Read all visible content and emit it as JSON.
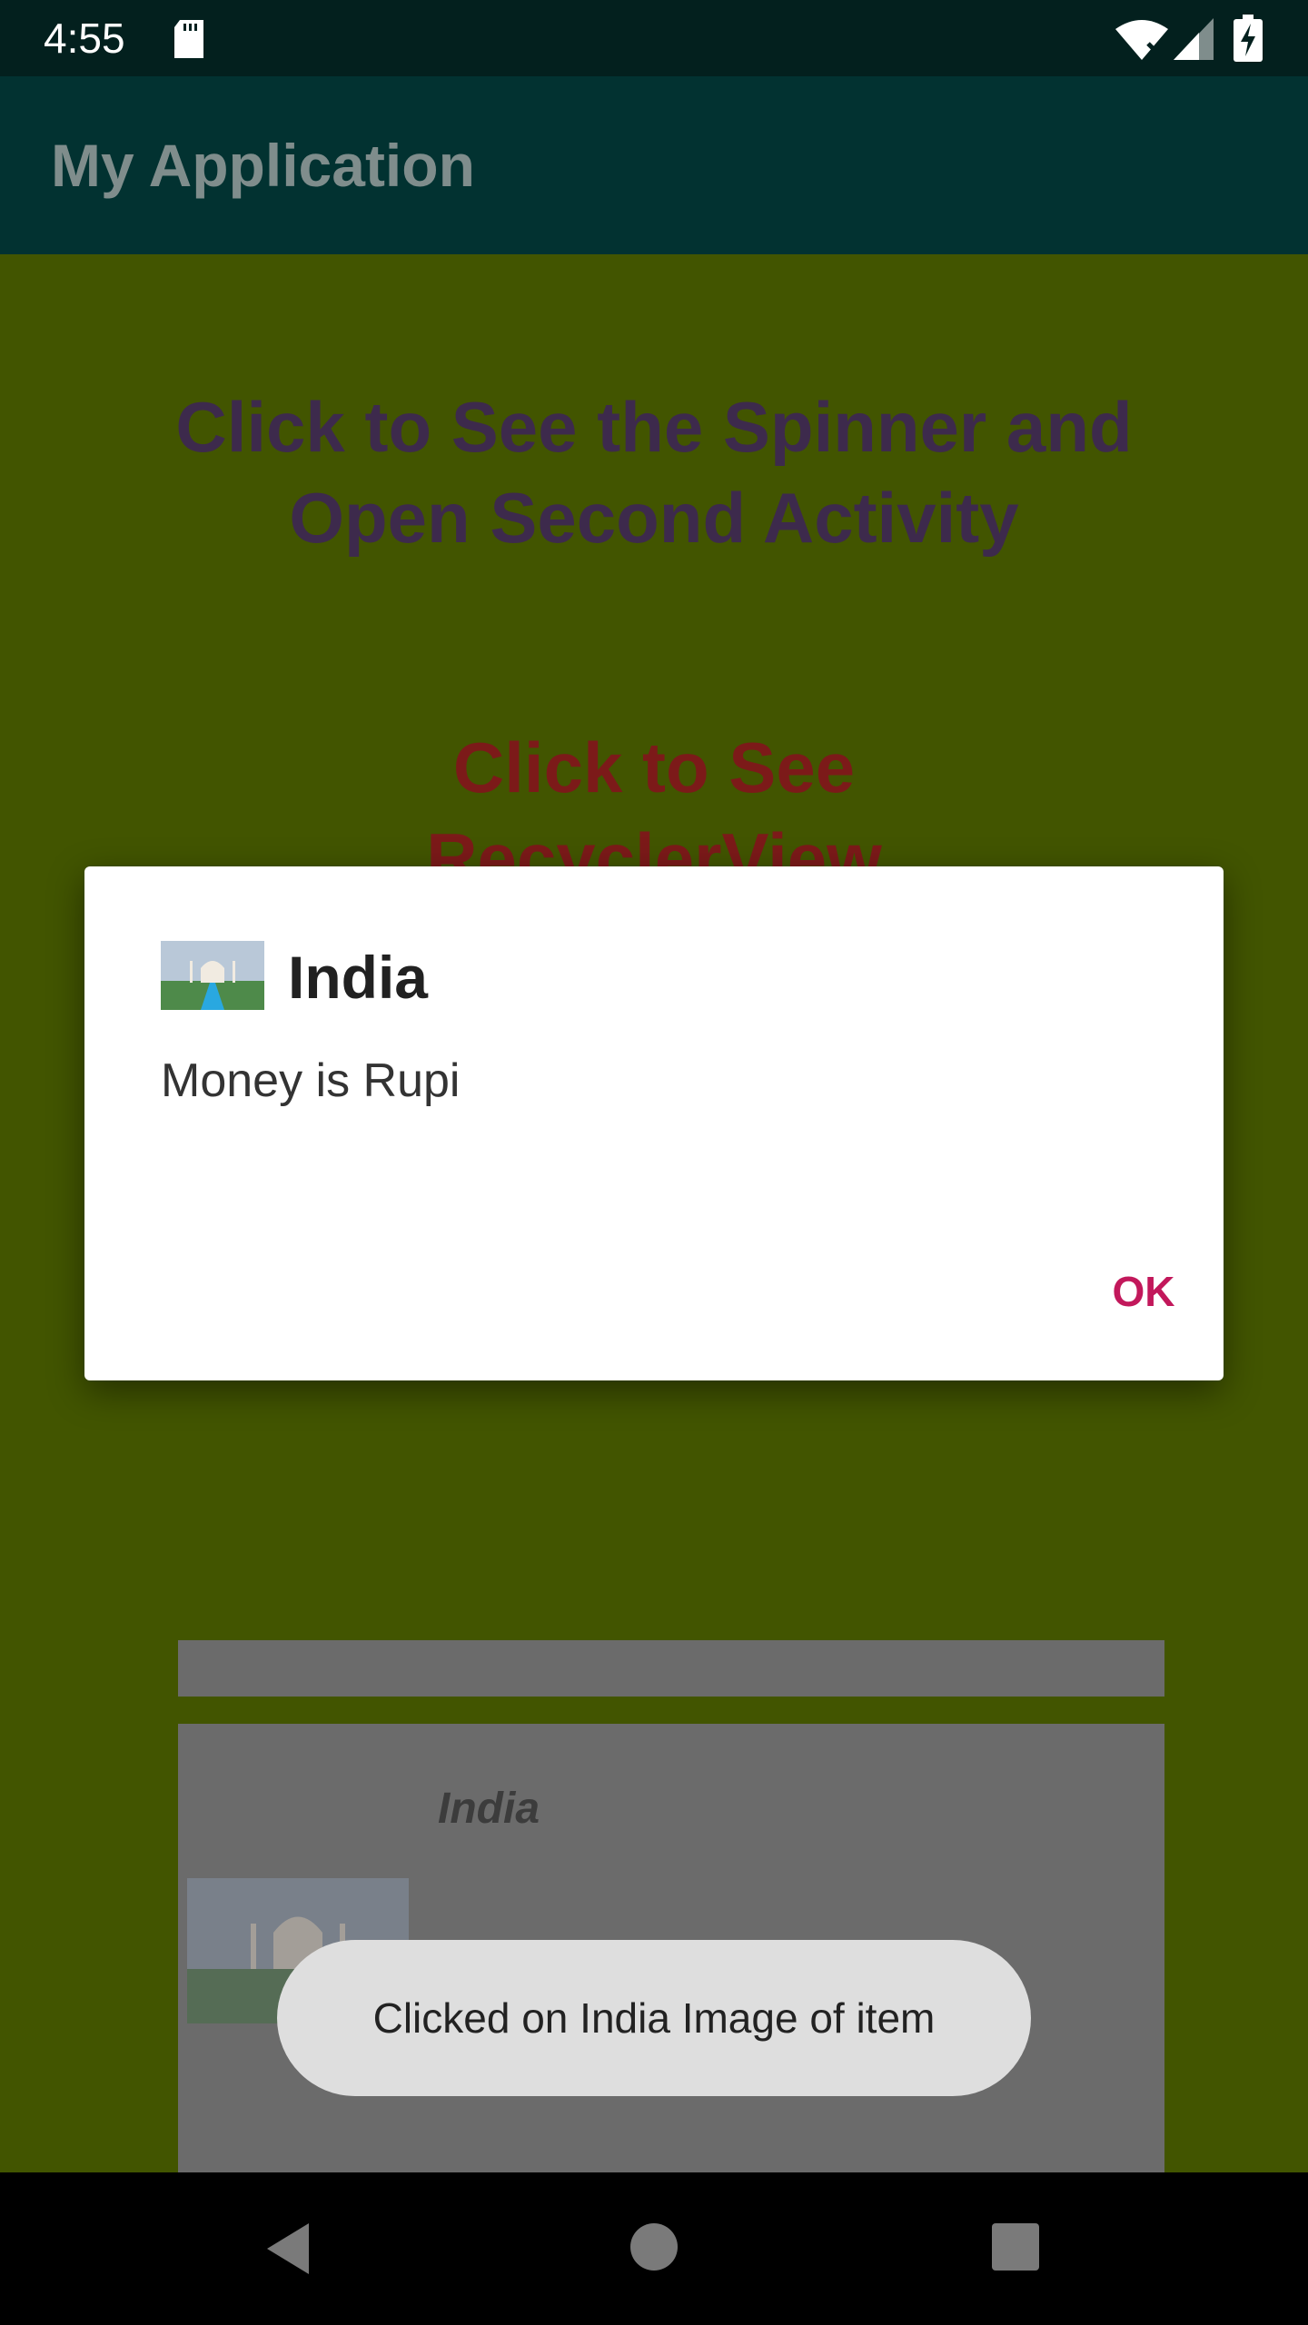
{
  "status_bar": {
    "time": "4:55"
  },
  "app_bar": {
    "title": "My Application"
  },
  "content": {
    "spinner_link": "Click to See the Spinner and Open Second Activity",
    "recycler_link_line1": "Click to See",
    "recycler_link_line2": "RecyclerView",
    "card": {
      "title": "India"
    }
  },
  "dialog": {
    "title": "India",
    "message": "Money is Rupi",
    "ok_label": "OK"
  },
  "toast": {
    "text": "Clicked on India Image of item"
  },
  "colors": {
    "status_bar": "#03201e",
    "app_bar": "#023231",
    "content_bg": "#425500",
    "accent": "#c2185b"
  }
}
